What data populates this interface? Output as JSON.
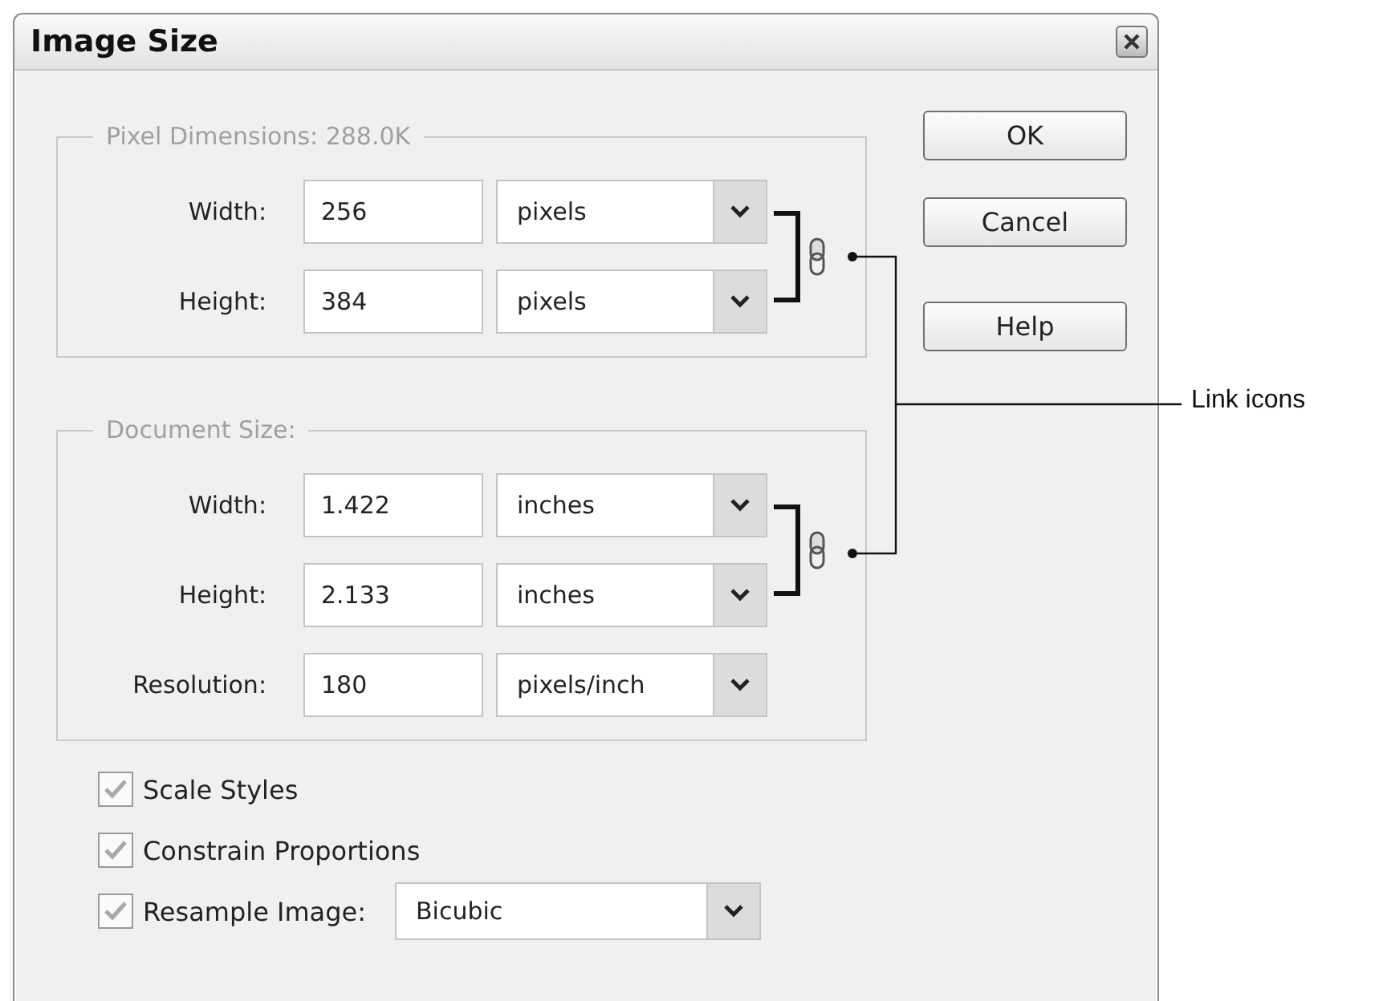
{
  "window": {
    "title": "Image Size"
  },
  "pixel_dimensions": {
    "title": "Pixel Dimensions: 288.0K",
    "fields": [
      {
        "label": "Width:",
        "value": "256",
        "unit": "pixels"
      },
      {
        "label": "Height:",
        "value": "384",
        "unit": "pixels"
      }
    ]
  },
  "document_size": {
    "title": "Document Size:",
    "fields": [
      {
        "label": "Width:",
        "value": "1.422",
        "unit": "inches"
      },
      {
        "label": "Height:",
        "value": "2.133",
        "unit": "inches"
      },
      {
        "label": "Resolution:",
        "value": "180",
        "unit": "pixels/inch"
      }
    ]
  },
  "options": [
    {
      "kind": "checkbox",
      "label": "Scale Styles",
      "checked": true
    },
    {
      "kind": "checkbox",
      "label": "Constrain Proportions",
      "checked": true
    },
    {
      "kind": "checkbox_dropdown",
      "label": "Resample Image:",
      "checked": true,
      "value": "Bicubic"
    }
  ],
  "buttons": [
    "OK",
    "Cancel",
    "Help"
  ],
  "callout": "Link icons"
}
